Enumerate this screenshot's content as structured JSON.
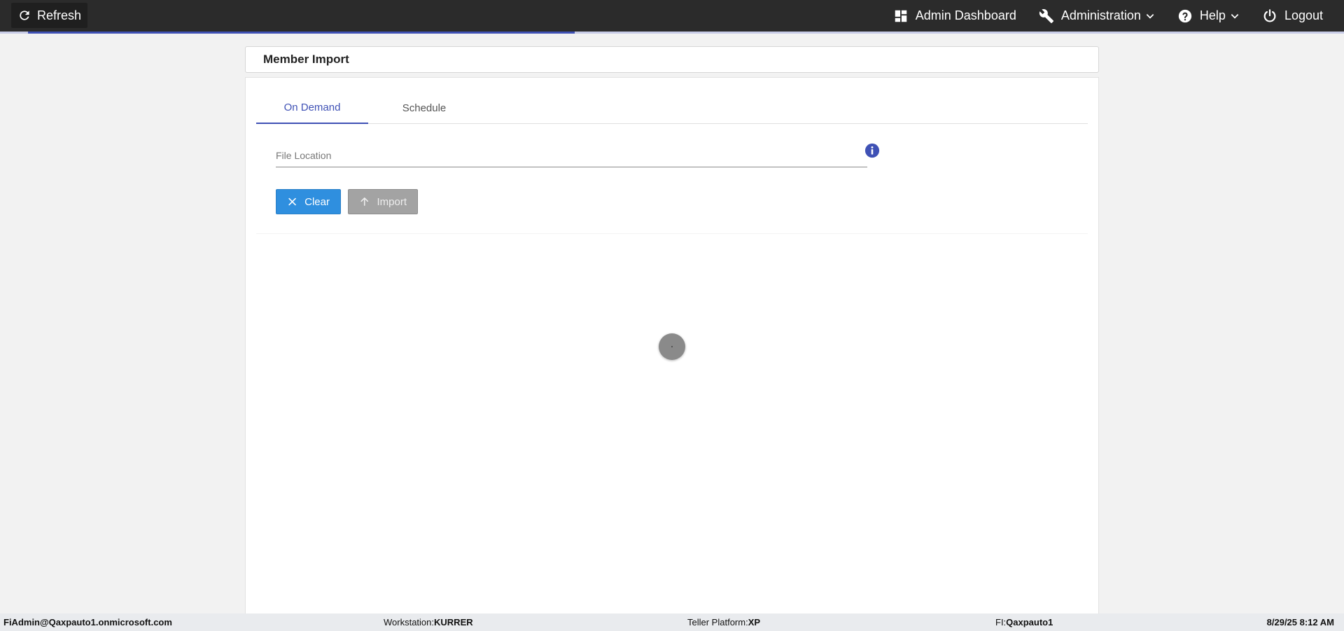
{
  "topbar": {
    "refresh_label": "Refresh",
    "nav": {
      "dashboard": "Admin Dashboard",
      "administration": "Administration",
      "help": "Help",
      "logout": "Logout"
    },
    "progress_fraction": 0.407
  },
  "page": {
    "title": "Member Import"
  },
  "tabs": [
    {
      "label": "On Demand",
      "active": true
    },
    {
      "label": "Schedule",
      "active": false
    }
  ],
  "form": {
    "file_location": {
      "placeholder": "File Location",
      "value": ""
    },
    "buttons": {
      "clear": "Clear",
      "import": "Import"
    }
  },
  "statusbar": {
    "user": "FiAdmin@Qaxpauto1.onmicrosoft.com",
    "workstation_label": "Workstation: ",
    "workstation_value": "KURRER",
    "platform_label": "Teller Platform: ",
    "platform_value": "XP",
    "fi_label": "FI: ",
    "fi_value": "Qaxpauto1",
    "datetime": "8/29/25 8:12 AM"
  },
  "icons": {
    "refresh": "refresh-icon",
    "dashboard": "dashboard-icon",
    "administration": "wrench-icon",
    "help": "help-circle-icon",
    "logout": "power-icon",
    "info": "info-icon",
    "clear": "close-icon",
    "import": "arrow-up-icon"
  },
  "colors": {
    "topbar_bg": "#2b2b2b",
    "accent": "#3f51b5",
    "clear_button": "#2f8fdf",
    "import_button_disabled": "#a3a3a3",
    "page_bg": "#f2f2f2"
  }
}
